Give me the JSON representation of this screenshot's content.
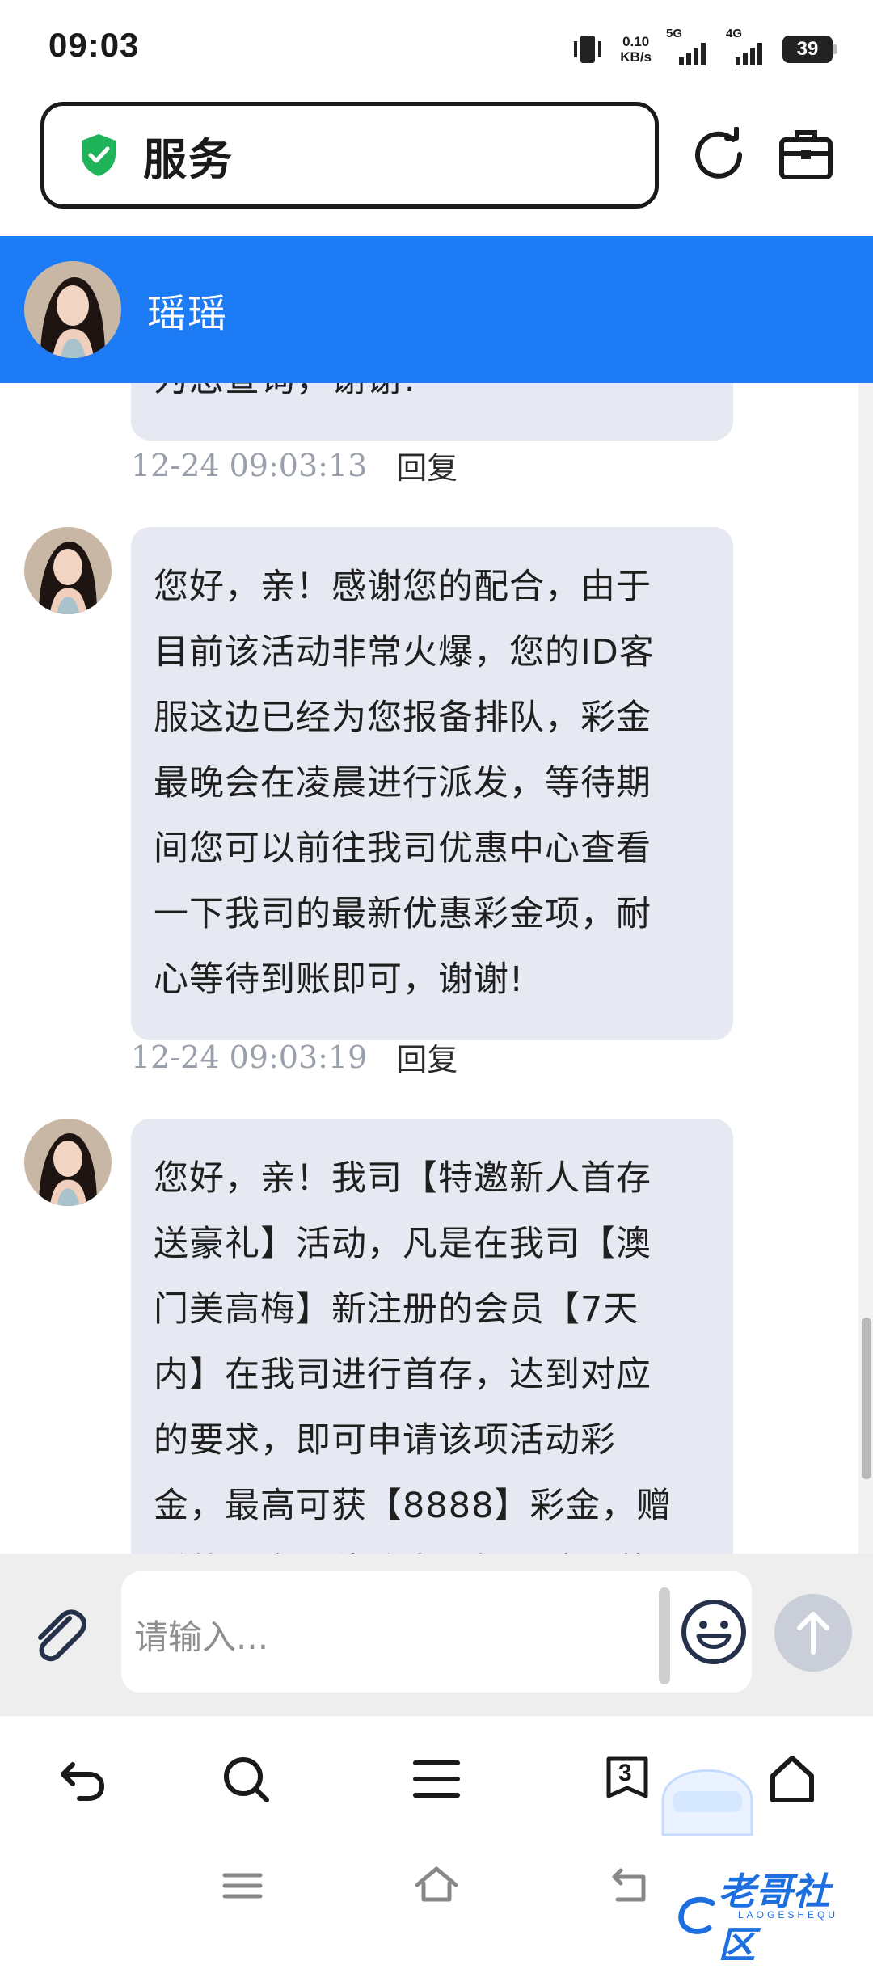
{
  "status_bar": {
    "time": "09:03",
    "net_speed_value": "0.10",
    "net_speed_unit": "KB/s",
    "signal1_label": "5G",
    "signal2_label": "4G",
    "battery": "39"
  },
  "browser": {
    "url_title": "服务"
  },
  "chat": {
    "agent_name": "瑶瑶",
    "messages": [
      {
        "lines": [
          "为您查询，谢谢!"
        ],
        "timestamp": "12-24 09:03:13",
        "reply_label": "回复"
      },
      {
        "lines": [
          "您好，亲！感谢您的配合，由于",
          "目前该活动非常火爆，您的ID客",
          "服这边已经为您报备排队，彩金",
          "最晚会在凌晨进行派发，等待期",
          "间您可以前往我司优惠中心查看",
          "一下我司的最新优惠彩金项，耐",
          "心等待到账即可，谢谢!"
        ],
        "timestamp": "12-24 09:03:19",
        "reply_label": "回复"
      },
      {
        "lines": [
          "您好，亲！我司【特邀新人首存",
          "送豪礼】活动，凡是在我司【澳",
          "门美高梅】新注册的会员【7天",
          "内】在我司进行首存，达到对应",
          "的要求，即可申请该项活动彩",
          "金，最高可获【8888】彩金，赠",
          "送的彩金一倍流水，提到建议使"
        ]
      }
    ]
  },
  "input": {
    "placeholder": "请输入..."
  },
  "bottom_bar": {
    "tab_count": "3"
  },
  "watermark": {
    "text": "老哥社区",
    "subtext": "LAOGESHEQU"
  },
  "colors": {
    "header_blue": "#1d7cf5",
    "bubble_bg": "#e6e9f1",
    "shield_green": "#1fb45a"
  }
}
